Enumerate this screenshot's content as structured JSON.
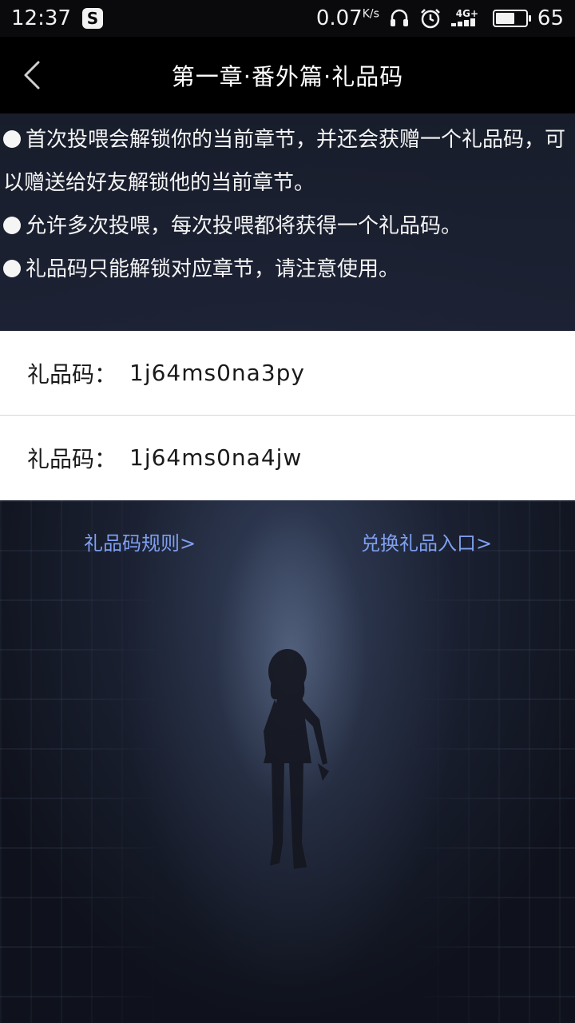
{
  "status_bar": {
    "time": "12:37",
    "app_badge": "S",
    "speed": "0.07",
    "speed_unit": "K/s",
    "network": "4G+",
    "battery_level": "65",
    "battery_fraction": 0.65,
    "icons": [
      "app-badge-icon",
      "headphones-icon",
      "alarm-icon",
      "network-signal-icon",
      "battery-icon"
    ]
  },
  "title_bar": {
    "back_icon": "chevron-left-icon",
    "title": "第一章·番外篇·礼品码"
  },
  "info": {
    "lines": [
      "首次投喂会解锁你的当前章节，并还会获赠一个礼品码，可以赠送给好友解锁他的当前章节。",
      "允许多次投喂，每次投喂都将获得一个礼品码。",
      "礼品码只能解锁对应章节，请注意使用。"
    ]
  },
  "codes": [
    {
      "label": "礼品码：",
      "value": "1j64ms0na3py"
    },
    {
      "label": "礼品码：",
      "value": "1j64ms0na4jw"
    }
  ],
  "links": {
    "rules": "礼品码规则>",
    "redeem": "兑换礼品入口>"
  },
  "colors": {
    "link": "#7f9ff0",
    "title_bar_bg": "#000000",
    "background": "#0d1019"
  }
}
